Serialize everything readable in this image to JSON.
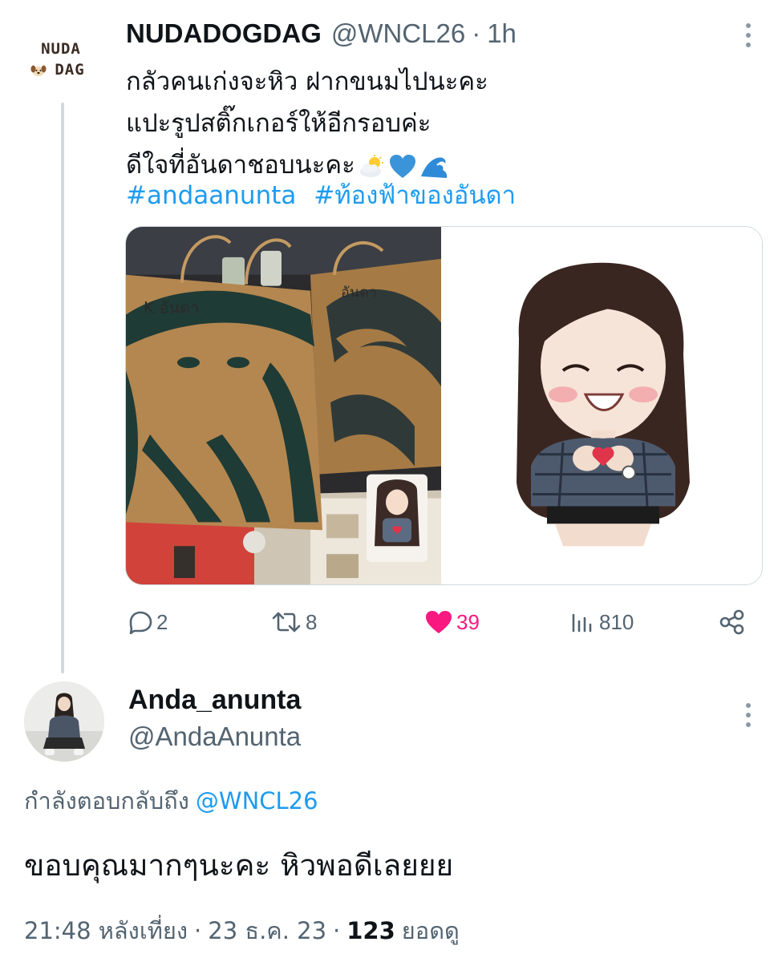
{
  "colors": {
    "link": "#1d9bf0",
    "like": "#f91880",
    "secondary_text": "#536471",
    "primary_text": "#0f1419",
    "thread_line": "#cfd9de"
  },
  "parent_tweet": {
    "avatar_logo": {
      "line1": "NUDA",
      "line2": "DAG",
      "icon": "dog-face-icon"
    },
    "author_name": "NUDADOGDAG",
    "handle": "@WNCL26",
    "separator": "·",
    "time": "1h",
    "text_lines": [
      "กลัวคนเก่งจะหิว ฝากขนมไปนะคะ",
      "แปะรูปสติ๊กเกอร์ให้อีกรอบค่ะ",
      "ดีใจที่อันดาชอบนะคะ"
    ],
    "emojis": [
      "sun-behind-cloud-icon",
      "blue-heart-icon",
      "water-wave-icon"
    ],
    "hashtags": [
      "#andaanunta",
      "#ท้องฟ้าของอันดา"
    ],
    "photo_left": {
      "bag_label_1": "K อันดา",
      "bag_label_2": "อันดา"
    },
    "actions": {
      "replies": "2",
      "retweets": "8",
      "likes": "39",
      "views": "810"
    }
  },
  "reply_tweet": {
    "author_name": "Anda_anunta",
    "handle": "@AndaAnunta",
    "replying_to_label": "กำลังตอบกลับถึง",
    "replying_to_handle": "@WNCL26",
    "text": "ขอบคุณมากๆนะคะ หิวพอดีเลยยย",
    "time": "21:48 หลังเที่ยง",
    "separator": "·",
    "date": "23 ธ.ค. 23",
    "views_count": "123",
    "views_label": "ยอดดู"
  }
}
